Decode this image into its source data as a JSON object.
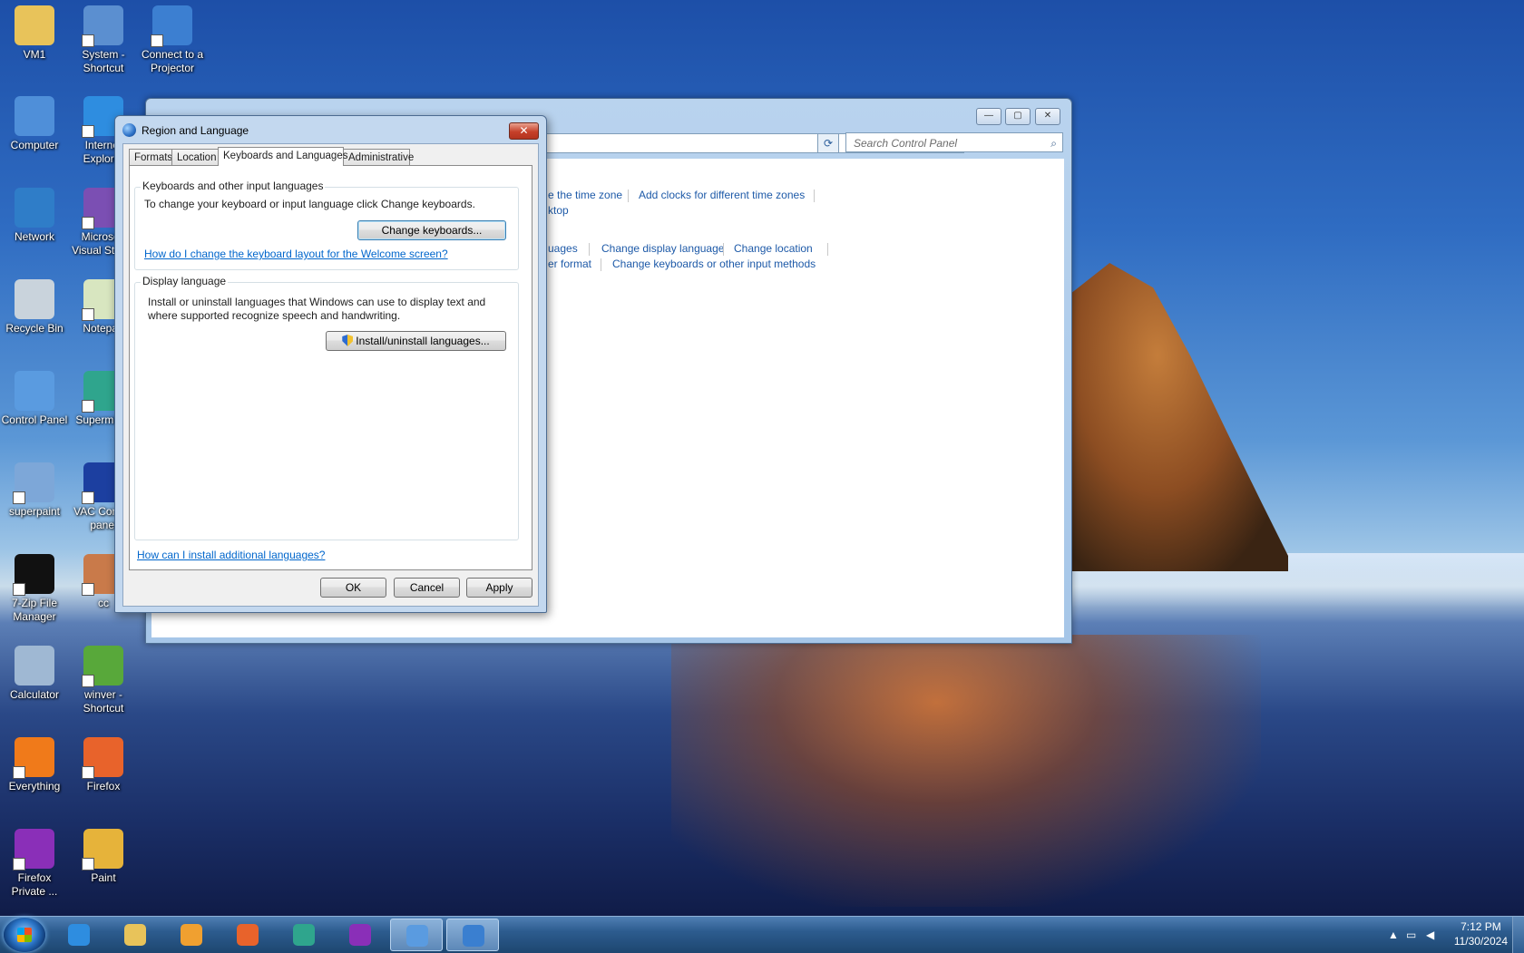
{
  "desktop": {
    "icons": [
      {
        "label": "VM1",
        "icon": "folder-user-icon",
        "color": "#e8c35a"
      },
      {
        "label": "System - Shortcut",
        "icon": "system-monitor-icon",
        "color": "#5b8fd0"
      },
      {
        "label": "Connect to a Projector",
        "icon": "projector-icon",
        "color": "#3c7fd1"
      },
      {
        "label": "Computer",
        "icon": "computer-icon",
        "color": "#4f8fd9"
      },
      {
        "label": "Internet Explorer",
        "icon": "internet-explorer-icon",
        "color": "#2e8de0"
      },
      {
        "label": "Network",
        "icon": "network-globe-icon",
        "color": "#2f7dc8"
      },
      {
        "label": "Microsoft Visual Studio",
        "icon": "visual-studio-icon",
        "color": "#7b4fb3"
      },
      {
        "label": "Recycle Bin",
        "icon": "recycle-bin-icon",
        "color": "#c9d3dc"
      },
      {
        "label": "Notepad",
        "icon": "notepad-icon",
        "color": "#d8e6c0"
      },
      {
        "label": "Control Panel",
        "icon": "control-panel-icon",
        "color": "#5a9be0"
      },
      {
        "label": "Supermium",
        "icon": "supermium-icon",
        "color": "#2fa58d"
      },
      {
        "label": "superpaint",
        "icon": "superpaint-icon",
        "color": "#7da7d8"
      },
      {
        "label": "VAC Control panel",
        "icon": "vac-icon",
        "color": "#1c3fa0"
      },
      {
        "label": "7-Zip File Manager",
        "icon": "7zip-icon",
        "color": "#111111"
      },
      {
        "label": "cc",
        "icon": "image-file-icon",
        "color": "#c97a4a"
      },
      {
        "label": "Calculator",
        "icon": "calculator-icon",
        "color": "#9fb8d3"
      },
      {
        "label": "winver - Shortcut",
        "icon": "windows-logo-icon",
        "color": "#58a83a"
      },
      {
        "label": "Everything",
        "icon": "everything-search-icon",
        "color": "#f07a1a"
      },
      {
        "label": "Firefox",
        "icon": "firefox-icon",
        "color": "#e8632b"
      },
      {
        "label": "Firefox Private ...",
        "icon": "firefox-private-icon",
        "color": "#8a2fb8"
      },
      {
        "label": "Paint",
        "icon": "paint-icon",
        "color": "#e6b33a"
      }
    ]
  },
  "control_panel": {
    "search_placeholder": "Search Control Panel",
    "links_row1": [
      "e the time zone",
      "Add clocks for different time zones"
    ],
    "link_row1b": "ktop",
    "links_row2": [
      "uages",
      "Change display language",
      "Change location"
    ],
    "links_row3": [
      "er format",
      "Change keyboards or other input methods"
    ]
  },
  "dialog": {
    "title": "Region and Language",
    "tabs": [
      "Formats",
      "Location",
      "Keyboards and Languages",
      "Administrative"
    ],
    "active_tab": "Keyboards and Languages",
    "keyboards_group": {
      "title": "Keyboards and other input languages",
      "description": "To change your keyboard or input language click Change keyboards.",
      "button": "Change keyboards...",
      "link": "How do I change the keyboard layout for the Welcome screen?"
    },
    "display_group": {
      "title": "Display language",
      "description_line1": "Install or uninstall languages that Windows can use to display text and",
      "description_line2": "where supported recognize speech and handwriting.",
      "button": "Install/uninstall languages..."
    },
    "bottom_link": "How can I install additional languages?",
    "buttons": {
      "ok": "OK",
      "cancel": "Cancel",
      "apply": "Apply"
    }
  },
  "taskbar": {
    "items": [
      {
        "icon": "internet-explorer-icon",
        "color": "#2e8de0",
        "open": false
      },
      {
        "icon": "file-explorer-icon",
        "color": "#e8c35a",
        "open": false
      },
      {
        "icon": "media-player-icon",
        "color": "#f0a030",
        "open": false
      },
      {
        "icon": "firefox-icon",
        "color": "#e8632b",
        "open": false
      },
      {
        "icon": "supermium-icon",
        "color": "#2fa58d",
        "open": false
      },
      {
        "icon": "firefox-private-icon",
        "color": "#8a2fb8",
        "open": false
      },
      {
        "icon": "control-panel-icon",
        "color": "#5a9be0",
        "open": true
      },
      {
        "icon": "region-language-icon",
        "color": "#3a7fd0",
        "open": true
      }
    ],
    "time": "7:12 PM",
    "date": "11/30/2024"
  }
}
